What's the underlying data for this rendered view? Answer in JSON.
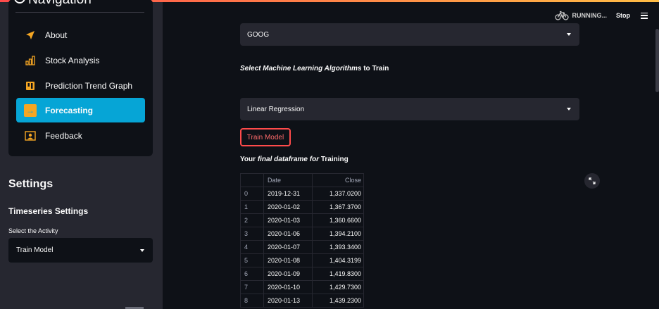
{
  "theme": {
    "accent": "#ff4b4b",
    "active_nav": "#06a5d6",
    "icon_color": "#f5a623"
  },
  "sidebar": {
    "nav_title": "Navigation",
    "items": [
      {
        "label": "About",
        "icon": "send-icon"
      },
      {
        "label": "Stock Analysis",
        "icon": "bar-chart-icon"
      },
      {
        "label": "Prediction Trend Graph",
        "icon": "trend-icon"
      },
      {
        "label": "Forecasting",
        "icon": "arrow-right-box-icon",
        "active": true
      },
      {
        "label": "Feedback",
        "icon": "person-box-icon"
      }
    ],
    "settings_title": "Settings",
    "timeseries_title": "Timeseries Settings",
    "activity_label": "Select the Activity",
    "activity_value": "Train Model"
  },
  "header": {
    "status": "RUNNING...",
    "stop": "Stop"
  },
  "main": {
    "ticker_value": "GOOG",
    "algo_label_italic": "Select Machine Learning Algorithms",
    "algo_label_rest": " to Train",
    "algo_value": "Linear Regression",
    "train_button": "Train Model",
    "df_label_pre": "Your ",
    "df_label_italic": "final dataframe for",
    "df_label_post": " Training",
    "table": {
      "columns": [
        "",
        "Date",
        "Close"
      ],
      "rows": [
        [
          "0",
          "2019-12-31",
          "1,337.0200"
        ],
        [
          "1",
          "2020-01-02",
          "1,367.3700"
        ],
        [
          "2",
          "2020-01-03",
          "1,360.6600"
        ],
        [
          "3",
          "2020-01-06",
          "1,394.2100"
        ],
        [
          "4",
          "2020-01-07",
          "1,393.3400"
        ],
        [
          "5",
          "2020-01-08",
          "1,404.3199"
        ],
        [
          "6",
          "2020-01-09",
          "1,419.8300"
        ],
        [
          "7",
          "2020-01-10",
          "1,429.7300"
        ],
        [
          "8",
          "2020-01-13",
          "1,439.2300"
        ]
      ]
    }
  }
}
